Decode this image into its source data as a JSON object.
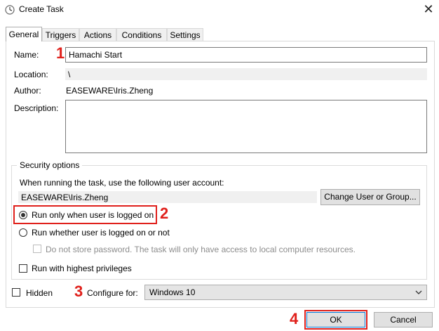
{
  "window": {
    "title": "Create Task"
  },
  "tabs": [
    {
      "label": "General"
    },
    {
      "label": "Triggers"
    },
    {
      "label": "Actions"
    },
    {
      "label": "Conditions"
    },
    {
      "label": "Settings"
    }
  ],
  "general": {
    "name_label": "Name:",
    "name_value": "Hamachi Start",
    "location_label": "Location:",
    "location_value": "\\",
    "author_label": "Author:",
    "author_value": "EASEWARE\\Iris.Zheng",
    "description_label": "Description:",
    "description_value": ""
  },
  "security": {
    "group_label": "Security options",
    "account_prompt": "When running the task, use the following user account:",
    "account_value": "EASEWARE\\Iris.Zheng",
    "change_button": "Change User or Group...",
    "radio_logged_on": "Run only when user is logged on",
    "radio_whether": "Run whether user is logged on or not",
    "no_store_password": "Do not store password.  The task will only have access to local computer resources.",
    "highest_privileges": "Run with highest privileges"
  },
  "bottom": {
    "hidden_label": "Hidden",
    "configure_label": "Configure for:",
    "configure_value": "Windows 10"
  },
  "buttons": {
    "ok": "OK",
    "cancel": "Cancel"
  },
  "annotations": {
    "n1": "1",
    "n2": "2",
    "n3": "3",
    "n4": "4"
  },
  "colors": {
    "annotation_red": "#e0201b",
    "accent_blue": "#0078d7"
  }
}
